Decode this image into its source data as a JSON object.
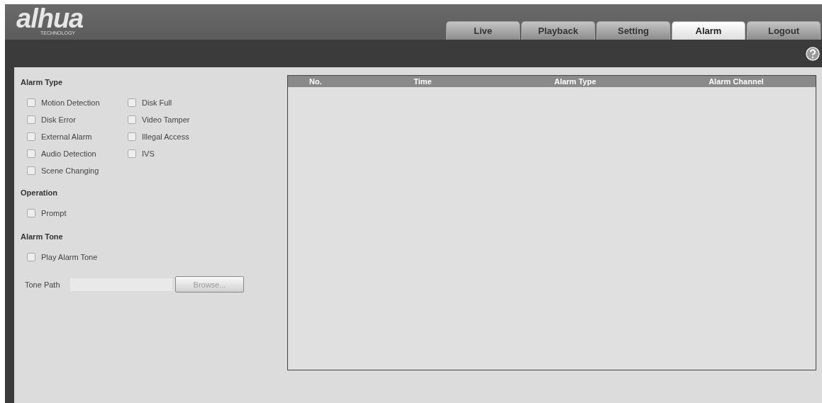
{
  "logo": {
    "name": "alhua",
    "tagline": "TECHNOLOGY"
  },
  "tabs": [
    {
      "label": "Live",
      "selected": false
    },
    {
      "label": "Playback",
      "selected": false
    },
    {
      "label": "Setting",
      "selected": false
    },
    {
      "label": "Alarm",
      "selected": true
    },
    {
      "label": "Logout",
      "selected": false
    }
  ],
  "alarm_type": {
    "title": "Alarm Type",
    "options": [
      {
        "label": "Motion Detection",
        "checked": false
      },
      {
        "label": "Disk Full",
        "checked": false
      },
      {
        "label": "Disk Error",
        "checked": false
      },
      {
        "label": "Video Tamper",
        "checked": false
      },
      {
        "label": "External Alarm",
        "checked": false
      },
      {
        "label": "Illegal Access",
        "checked": false
      },
      {
        "label": "Audio Detection",
        "checked": false
      },
      {
        "label": "IVS",
        "checked": false
      },
      {
        "label": "Scene Changing",
        "checked": false
      }
    ]
  },
  "operation": {
    "title": "Operation",
    "options": [
      {
        "label": "Prompt",
        "checked": false
      }
    ]
  },
  "alarm_tone": {
    "title": "Alarm Tone",
    "options": [
      {
        "label": "Play Alarm Tone",
        "checked": false
      }
    ],
    "path_label": "Tone Path",
    "browse": {
      "label": "Browse...",
      "disabled": true
    }
  },
  "table": {
    "columns": [
      "No.",
      "Time",
      "Alarm Type",
      "Alarm Channel"
    ]
  }
}
